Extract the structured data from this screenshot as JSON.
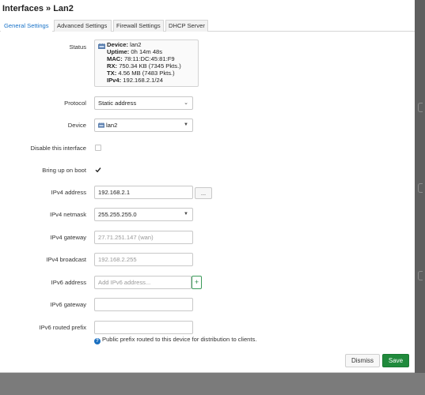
{
  "title": "Interfaces » Lan2",
  "tabs": [
    {
      "label": "General Settings",
      "active": true
    },
    {
      "label": "Advanced Settings",
      "active": false
    },
    {
      "label": "Firewall Settings",
      "active": false
    },
    {
      "label": "DHCP Server",
      "active": false
    }
  ],
  "status": {
    "label": "Status",
    "device_key": "Device:",
    "device_val": "lan2",
    "uptime_key": "Uptime:",
    "uptime_val": "0h 14m 48s",
    "mac_key": "MAC:",
    "mac_val": "78:11:DC:45:81:F9",
    "rx_key": "RX:",
    "rx_val": "750.34 KB (7345 Pkts.)",
    "tx_key": "TX:",
    "tx_val": "4.56 MB (7483 Pkts.)",
    "ipv4_key": "IPv4:",
    "ipv4_val": "192.168.2.1/24"
  },
  "protocol": {
    "label": "Protocol",
    "value": "Static address"
  },
  "device": {
    "label": "Device",
    "value": "lan2"
  },
  "disable_interface": {
    "label": "Disable this interface",
    "checked": false
  },
  "bring_up_on_boot": {
    "label": "Bring up on boot",
    "checked": true
  },
  "ipv4_address": {
    "label": "IPv4 address",
    "value": "192.168.2.1",
    "more_button": "..."
  },
  "ipv4_netmask": {
    "label": "IPv4 netmask",
    "value": "255.255.255.0"
  },
  "ipv4_gateway": {
    "label": "IPv4 gateway",
    "placeholder": "27.71.251.147 (wan)"
  },
  "ipv4_broadcast": {
    "label": "IPv4 broadcast",
    "placeholder": "192.168.2.255"
  },
  "ipv6_address": {
    "label": "IPv6 address",
    "placeholder": "Add IPv6 address...",
    "add_button": "+"
  },
  "ipv6_gateway": {
    "label": "IPv6 gateway",
    "value": ""
  },
  "ipv6_routed_prefix": {
    "label": "IPv6 routed prefix",
    "value": "",
    "help_icon": "?",
    "help": "Public prefix routed to this device for distribution to clients."
  },
  "footer": {
    "dismiss_label": "Dismiss",
    "save_label": "Save"
  },
  "colors": {
    "accent": "#1a73c8",
    "save": "#208a3c",
    "add_border": "#3c9b5a"
  }
}
